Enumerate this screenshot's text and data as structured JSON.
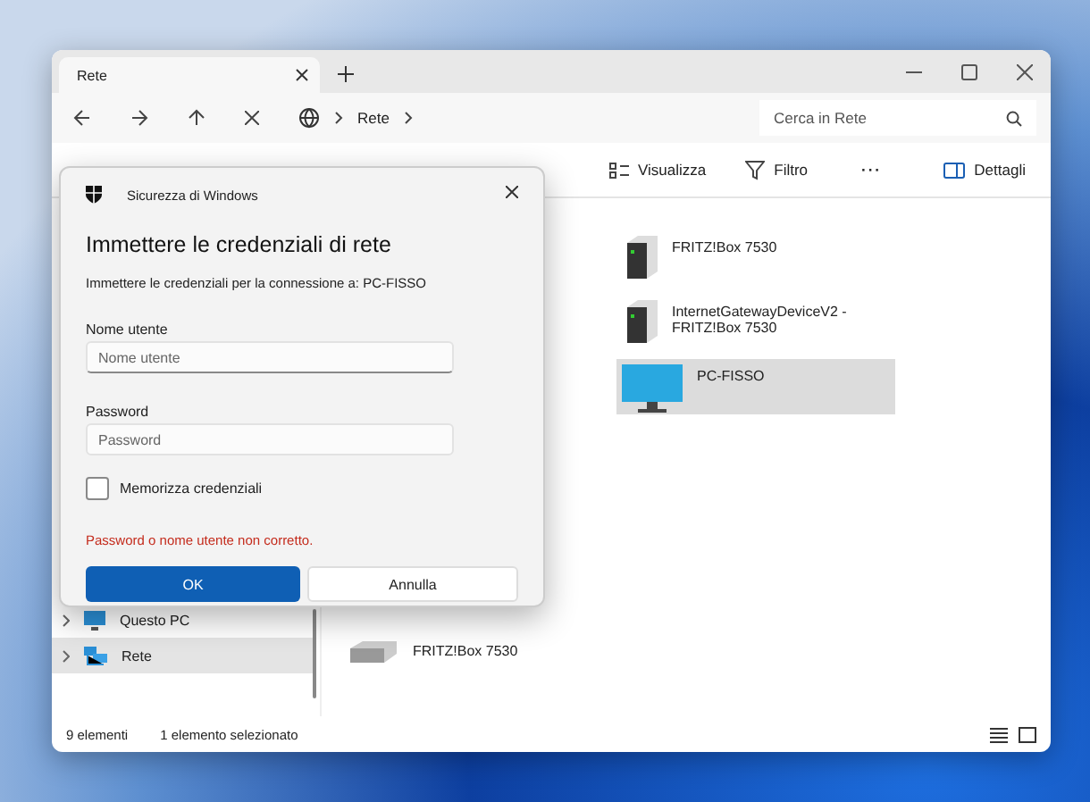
{
  "window": {
    "tabs": [
      {
        "label": "Rete",
        "selected": true
      }
    ]
  },
  "address": {
    "crumbs": [
      "Rete"
    ]
  },
  "search": {
    "placeholder": "Cerca in Rete"
  },
  "toolbar": [
    {
      "kind": "view",
      "label": "Visualizza"
    },
    {
      "kind": "filter",
      "label": "Filtro"
    },
    {
      "kind": "more",
      "label": "···"
    },
    {
      "kind": "details",
      "label": "Dettagli"
    }
  ],
  "sidebar": {
    "items": [
      {
        "kind": "pc",
        "label": "Questo PC",
        "selected": false
      },
      {
        "kind": "network",
        "label": "Rete",
        "selected": true
      }
    ]
  },
  "items": [
    {
      "kind": "server",
      "label": "FRITZ!Box 7530",
      "selected": false
    },
    {
      "kind": "server",
      "label": "InternetGatewayDeviceV2 - FRITZ!Box 7530",
      "selected": false
    },
    {
      "kind": "monitor",
      "label": "PC-FISSO",
      "selected": true
    }
  ],
  "bottom_items": [
    {
      "kind": "router",
      "label": "FRITZ!Box 7530",
      "selected": false
    }
  ],
  "status_bar": {
    "count": "9 elementi",
    "selection": "1 elemento selezionato"
  },
  "dialog": {
    "app": "Sicurezza di Windows",
    "title": "Immettere le credenziali di rete",
    "subtitle": "Immettere le credenziali per la connessione a: PC-FISSO",
    "fields": [
      {
        "label": "Nome utente",
        "placeholder": "Nome utente"
      },
      {
        "label": "Password",
        "placeholder": "Password"
      }
    ],
    "remember": {
      "label": "Memorizza credenziali",
      "checked": false
    },
    "error": "Password o nome utente non corretto.",
    "buttons": [
      {
        "label": "OK",
        "kind": "primary"
      },
      {
        "label": "Annulla",
        "kind": "secondary"
      }
    ]
  }
}
